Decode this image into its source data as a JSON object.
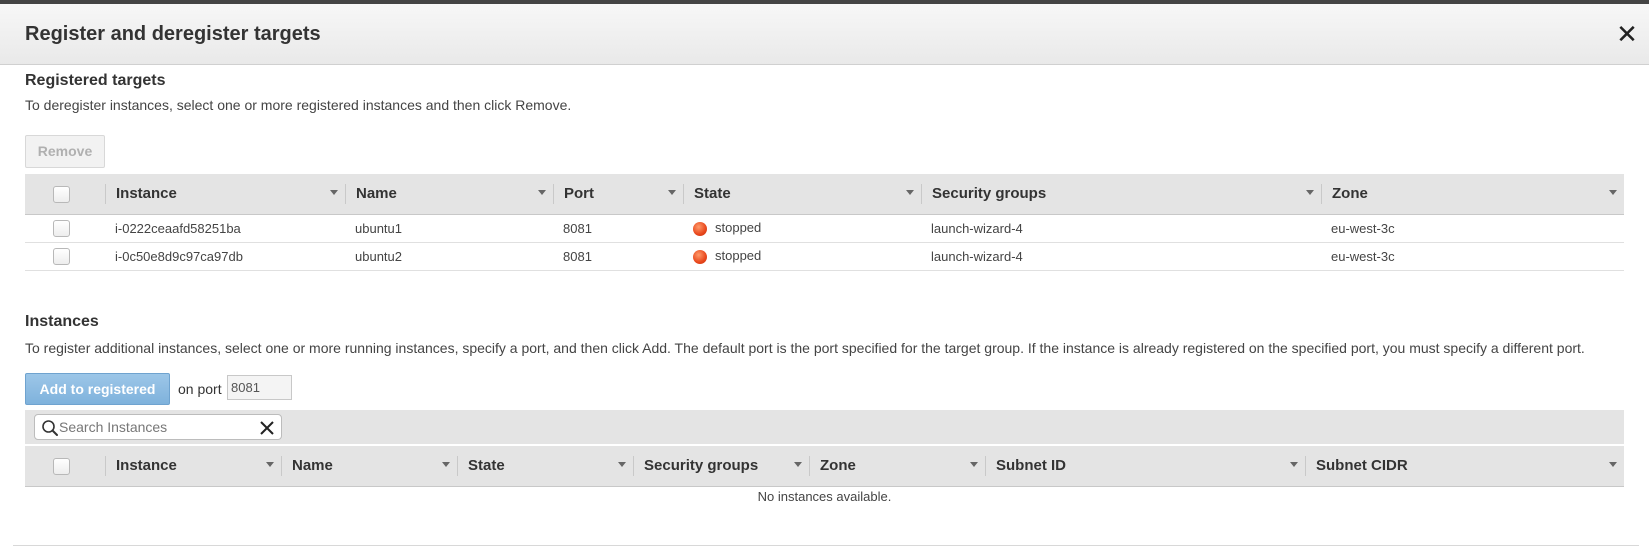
{
  "modal": {
    "title": "Register and deregister targets",
    "close_glyph": "✕"
  },
  "registered": {
    "title": "Registered targets",
    "description": "To deregister instances, select one or more registered instances and then click Remove.",
    "remove_label": "Remove",
    "columns": [
      "Instance",
      "Name",
      "Port",
      "State",
      "Security groups",
      "Zone"
    ],
    "rows": [
      {
        "instance": "i-0222ceaafd58251ba",
        "name": "ubuntu1",
        "port": "8081",
        "state": "stopped",
        "security_groups": "launch-wizard-4",
        "zone": "eu-west-3c"
      },
      {
        "instance": "i-0c50e8d9c97ca97db",
        "name": "ubuntu2",
        "port": "8081",
        "state": "stopped",
        "security_groups": "launch-wizard-4",
        "zone": "eu-west-3c"
      }
    ]
  },
  "instances": {
    "title": "Instances",
    "description": "To register additional instances, select one or more running instances, specify a port, and then click Add. The default port is the port specified for the target group. If the instance is already registered on the specified port, you must specify a different port.",
    "add_label": "Add to registered",
    "port_label": "on port",
    "port_value": "8081",
    "search_placeholder": "Search Instances",
    "columns": [
      "Instance",
      "Name",
      "State",
      "Security groups",
      "Zone",
      "Subnet ID",
      "Subnet CIDR"
    ],
    "empty_message": "No instances available."
  },
  "colors": {
    "stopped_state": "#e8471c",
    "primary_button": "#7fb2dc",
    "header_bg": "#e4e4e4"
  },
  "icons": {
    "close": "close-icon",
    "search": "search-icon",
    "clear": "clear-search-icon",
    "sort": "sort-caret-icon",
    "state": "status-dot-icon"
  }
}
